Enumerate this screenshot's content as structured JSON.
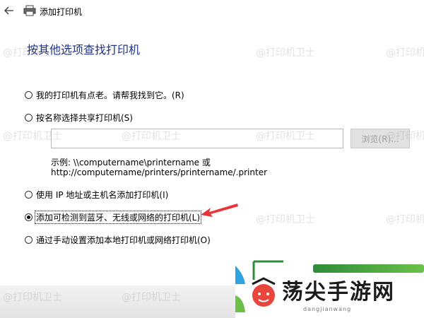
{
  "window": {
    "title": "添加打印机"
  },
  "page": {
    "heading": "按其他选项查找打印机"
  },
  "options": [
    {
      "label": "我的打印机有点老。请帮我找到它。(R)",
      "checked": false
    },
    {
      "label": "按名称选择共享打印机(S)",
      "checked": false
    },
    {
      "label": "使用 IP 地址或主机名添加打印机(I)",
      "checked": false
    },
    {
      "label": "添加可检测到蓝牙、无线或网络的打印机(L)",
      "checked": true
    },
    {
      "label": "通过手动设置添加本地打印机或网络打印机(O)",
      "checked": false
    }
  ],
  "share_field": {
    "value": "",
    "browse_label": "浏览(R)..."
  },
  "example": {
    "line1": "示例: \\\\computername\\printername 或",
    "line2": "http://computername/printers/printername/.printer"
  },
  "watermark": {
    "text": "@打印机卫士"
  },
  "logo": {
    "big_text": "荡尖手游网",
    "small_text": "dangjianwang"
  },
  "colors": {
    "heading": "#1e3287",
    "arrow": "#e8333a",
    "logo_green": "#2e8b3a"
  }
}
